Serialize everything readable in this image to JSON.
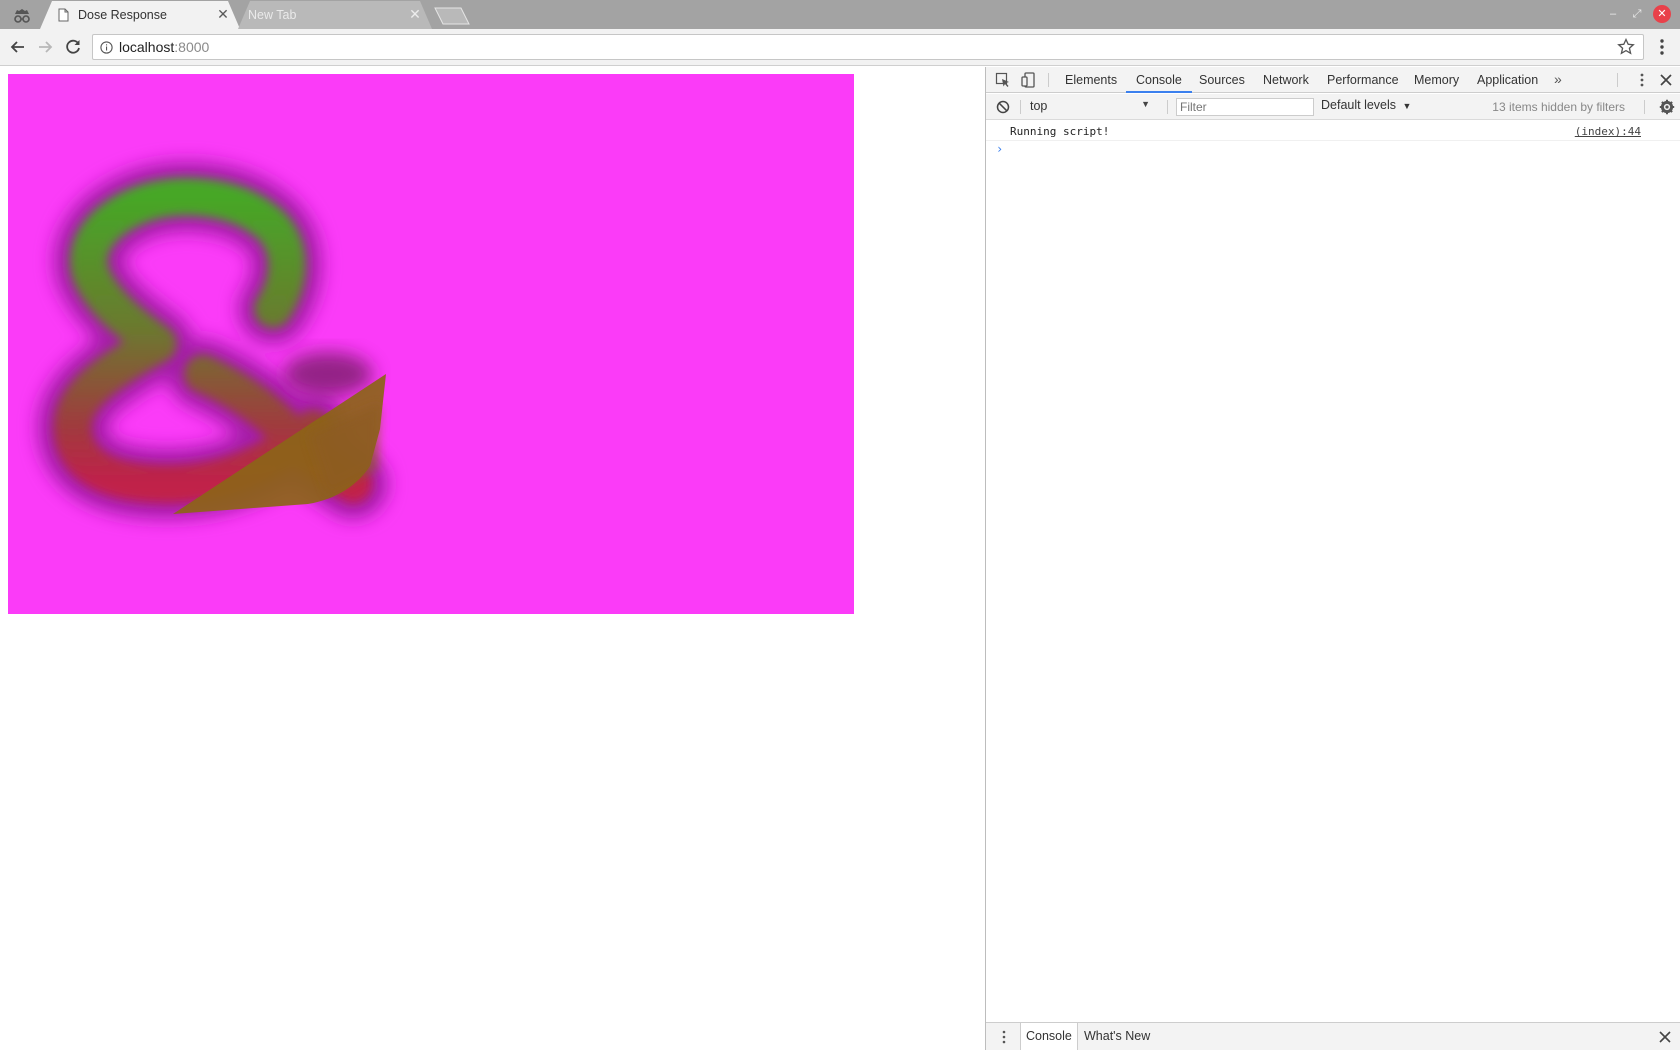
{
  "browser": {
    "tabs": [
      {
        "title": "Dose Response",
        "active": true,
        "close": "✕"
      },
      {
        "title": "New Tab",
        "active": false,
        "close": "✕"
      }
    ],
    "window_controls": {
      "minimize": "–",
      "maximize": "⤢",
      "close": "✕"
    },
    "url_host": "localhost",
    "url_port": ":8000"
  },
  "page": {
    "canvas_color": "#fb3bf8"
  },
  "devtools": {
    "tabs": [
      "Elements",
      "Console",
      "Sources",
      "Network",
      "Performance",
      "Memory",
      "Application"
    ],
    "active_tab": "Console",
    "more_tabs": "»",
    "context": "top",
    "filter_placeholder": "Filter",
    "levels": "Default levels",
    "levels_arrow": "▼",
    "hidden_count": "13 items hidden by filters",
    "console_messages": [
      {
        "text": "Running script!",
        "source": "(index):44"
      }
    ],
    "prompt": "›",
    "drawer_tabs": [
      "Console",
      "What's New"
    ]
  },
  "colors": {
    "accent": "#3b80ee",
    "close_button": "#e9414a"
  }
}
